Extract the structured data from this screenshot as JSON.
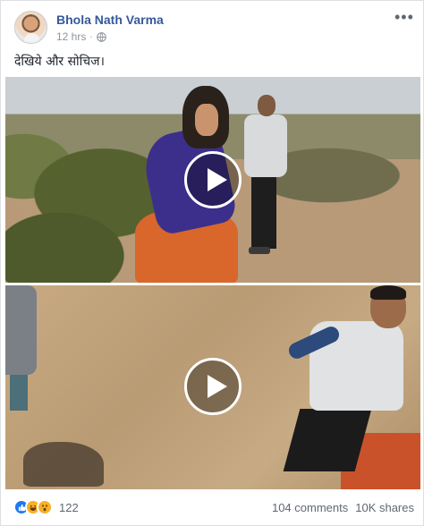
{
  "post": {
    "author": "Bhola Nath Varma",
    "timestamp": "12 hrs",
    "separator": "·",
    "privacy_icon": "globe-icon",
    "more_icon": "more-options-icon",
    "caption": "देखिये और सोचिज।"
  },
  "videos": [
    {
      "play_icon": "play-icon"
    },
    {
      "play_icon": "play-icon"
    }
  ],
  "footer": {
    "reaction_icons": [
      "like-icon",
      "haha-icon",
      "wow-icon"
    ],
    "reaction_count": "122",
    "comments": "104 comments",
    "shares": "10K shares"
  },
  "colors": {
    "author_link": "#365899",
    "meta_text": "#90949c",
    "like_blue": "#2078f4",
    "emoji_yellow": "#f7b125"
  }
}
